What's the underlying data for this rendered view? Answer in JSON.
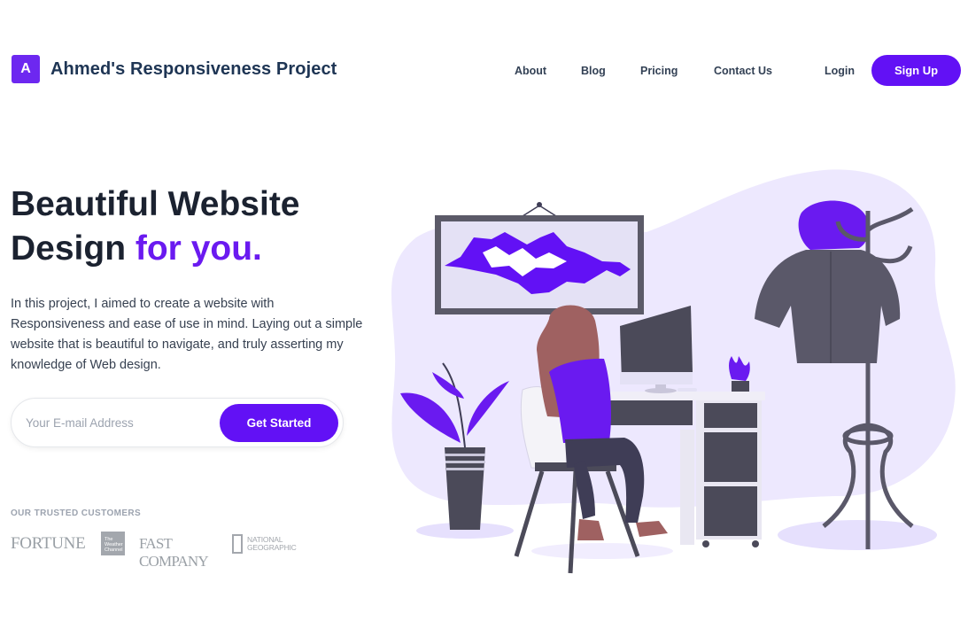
{
  "brand": {
    "badge": "A",
    "title": "Ahmed's Responsiveness Project"
  },
  "nav": {
    "items": [
      "About",
      "Blog",
      "Pricing",
      "Contact Us"
    ],
    "login": "Login",
    "signup": "Sign Up"
  },
  "hero": {
    "title_line1": "Beautiful Website",
    "title_line2_plain": "Design ",
    "title_line2_accent": "for you.",
    "description": "In this project, I aimed to create a website with Responsiveness and ease of use in mind. Laying out a simple website that is beautiful to navigate, and truly asserting my knowledge of Web design.",
    "email_placeholder": "Your E-mail Address",
    "cta": "Get Started"
  },
  "trusted": {
    "label": "OUR TRUSTED CUSTOMERS",
    "logos": {
      "fortune": "FORTUNE",
      "weather": "The Weather Channel",
      "fastcompany": "FAST COMPANY",
      "natgeo_line1": "NATIONAL",
      "natgeo_line2": "GEOGRAPHIC"
    }
  },
  "colors": {
    "brand_purple": "#6211f5",
    "accent_purple": "#6a1af0",
    "navy": "#1e3554",
    "blob_lavender": "#ede8fe",
    "illustration_gray": "#5a5869"
  }
}
